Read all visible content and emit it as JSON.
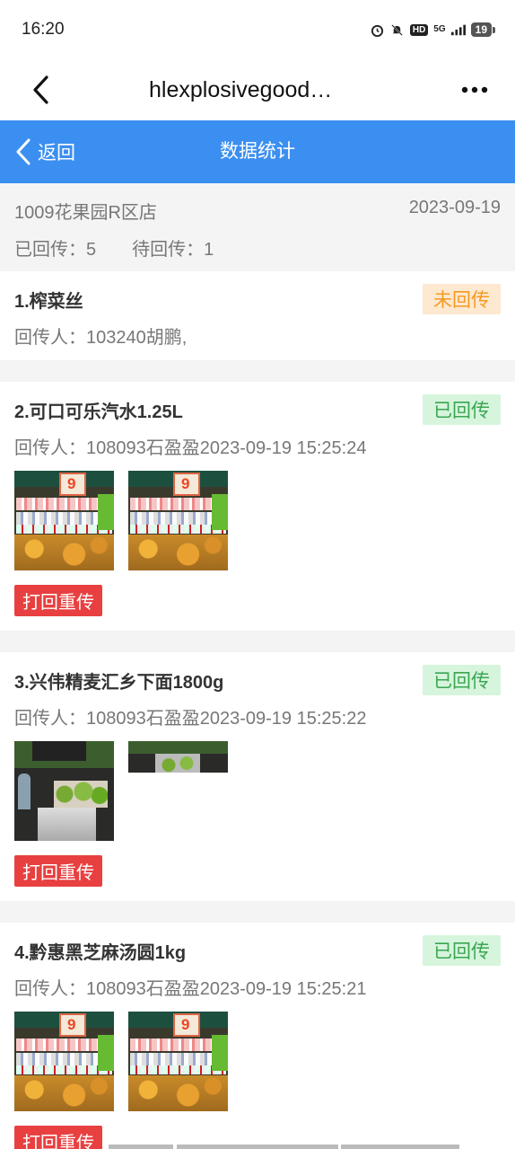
{
  "status_bar": {
    "time": "16:20",
    "hd": "HD",
    "network": "5G",
    "battery": "19"
  },
  "titlebar": {
    "title": "hlexplosivegood…"
  },
  "header": {
    "back_label": "返回",
    "title": "数据统计"
  },
  "summary": {
    "store": "1009花果园R区店",
    "date": "2023-09-19",
    "uploaded": "已回传：5",
    "pending": "待回传：1"
  },
  "items": [
    {
      "name": "1.榨菜丝",
      "status": "未回传",
      "sender": "回传人：103240胡鹏,",
      "redo_label": ""
    },
    {
      "name": "2.可口可乐汽水1.25L",
      "status": "已回传",
      "sender": "回传人：108093石盈盈2023-09-19 15:25:24",
      "redo_label": "打回重传"
    },
    {
      "name": "3.兴伟精麦汇乡下面1800g",
      "status": "已回传",
      "sender": "回传人：108093石盈盈2023-09-19 15:25:22",
      "redo_label": "打回重传"
    },
    {
      "name": "4.黔惠黑芝麻汤圆1kg",
      "status": "已回传",
      "sender": "回传人：108093石盈盈2023-09-19 15:25:21",
      "redo_label": "打回重传"
    }
  ],
  "photo_sign_text": "9"
}
